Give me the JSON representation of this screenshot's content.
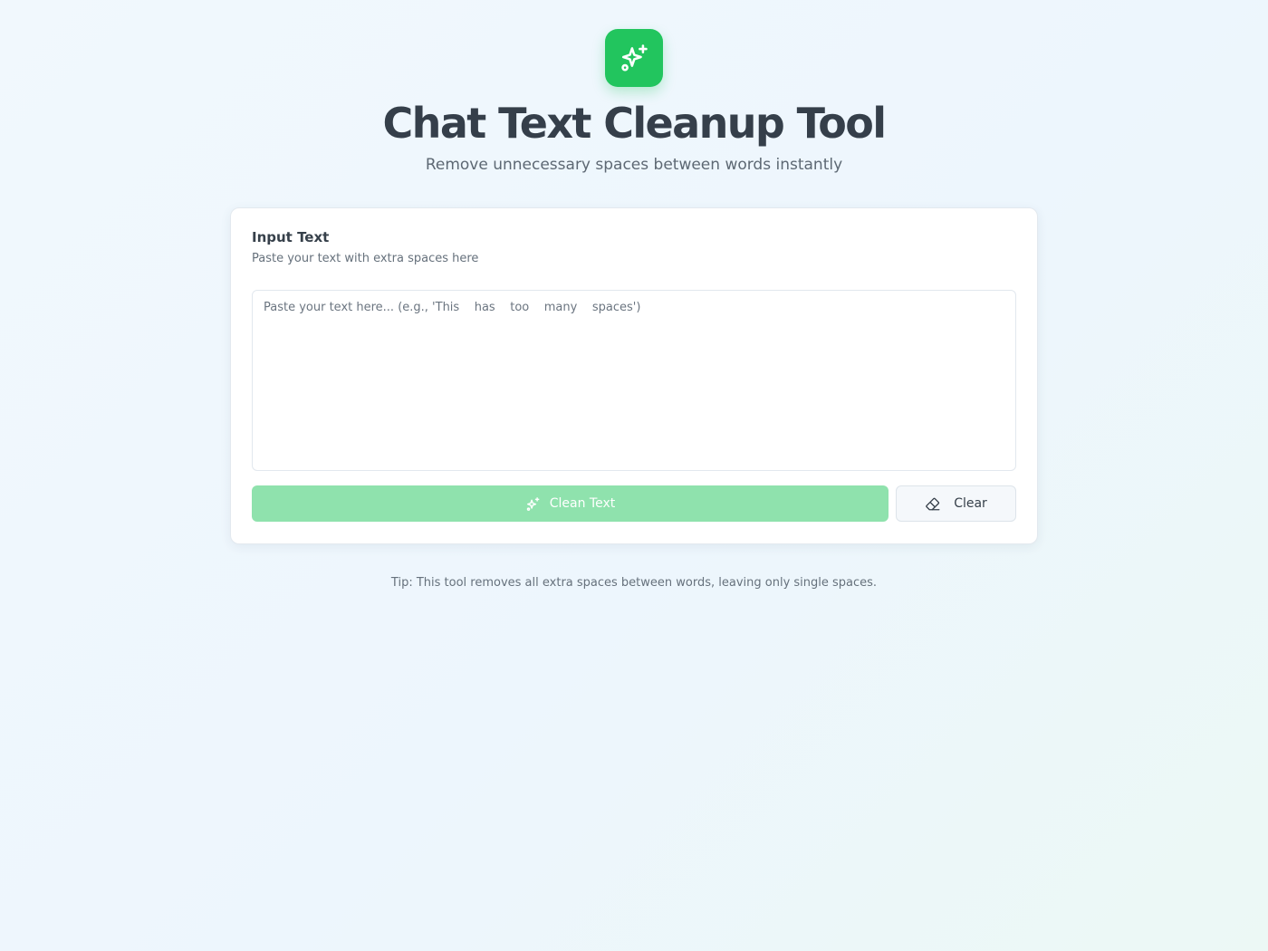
{
  "header": {
    "logo_icon": "sparkles-icon",
    "title": "Chat Text Cleanup Tool",
    "subtitle": "Remove unnecessary spaces between words instantly"
  },
  "card": {
    "title": "Input Text",
    "description": "Paste your text with extra spaces here",
    "input": {
      "value": "",
      "placeholder": "Paste your text here... (e.g., 'This    has    too    many    spaces')"
    },
    "clean_button": {
      "label": "Clean Text",
      "icon": "sparkles-icon",
      "enabled": false
    },
    "clear_button": {
      "label": "Clear",
      "icon": "eraser-icon"
    }
  },
  "footer": {
    "tip": "Tip: This tool removes all extra spaces between words, leaving only single spaces."
  },
  "colors": {
    "accent": "#22c55e",
    "accent_disabled": "#8fe2ad",
    "title_text": "#353f4a",
    "muted_text": "#66717c"
  }
}
